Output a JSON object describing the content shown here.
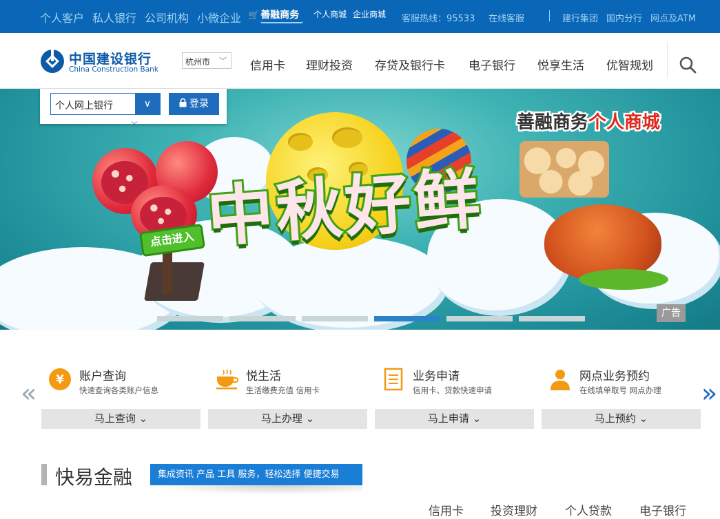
{
  "topbar": {
    "segments": [
      "个人客户",
      "私人银行",
      "公司机构",
      "小微企业"
    ],
    "shanrong": "善融商务",
    "mall_personal": "个人商城",
    "mall_enterprise": "企业商城",
    "hotline": "客服热线：95533",
    "online_service": "在线客服",
    "group": "建行集团",
    "domestic_branch": "国内分行",
    "atm": "网点及ATM"
  },
  "header": {
    "logo_cn": "中国建设银行",
    "logo_en": "China Construction Bank",
    "city": "杭州市",
    "nav": [
      "信用卡",
      "理财投资",
      "存贷及银行卡",
      "电子银行",
      "悦享生活",
      "优智规划"
    ]
  },
  "login": {
    "selected": "个人网上银行",
    "button": "登录"
  },
  "banner": {
    "headline": "中秋好鲜",
    "promo_prefix": "善融商务",
    "promo_suffix": "个人商城",
    "sign": "点击进入",
    "ad_badge": "广告",
    "slides_total": 6,
    "active_slide": 4
  },
  "services": [
    {
      "name": "账户查询",
      "desc": "快速查询各类账户信息",
      "button": "马上查询",
      "icon": "yen-icon"
    },
    {
      "name": "悦生活",
      "desc": "生活缴费充值 信用卡",
      "button": "马上办理",
      "icon": "cup-icon"
    },
    {
      "name": "业务申请",
      "desc": "信用卡、贷款快速申请",
      "button": "马上申请",
      "icon": "document-icon"
    },
    {
      "name": "网点业务预约",
      "desc": "在线填单取号 网点办理",
      "button": "马上预约",
      "icon": "person-icon"
    }
  ],
  "quick_finance": {
    "title": "快易金融",
    "tagline": "集成资讯 产品 工具 服务，轻松选择 便捷交易",
    "tabs": [
      "信用卡",
      "投资理财",
      "个人贷款",
      "电子银行"
    ]
  },
  "colors": {
    "topbar": "#0a66b6",
    "brand_blue": "#0d5aa7",
    "accent_blue": "#1a7ed6",
    "icon_orange": "#f39a12"
  }
}
